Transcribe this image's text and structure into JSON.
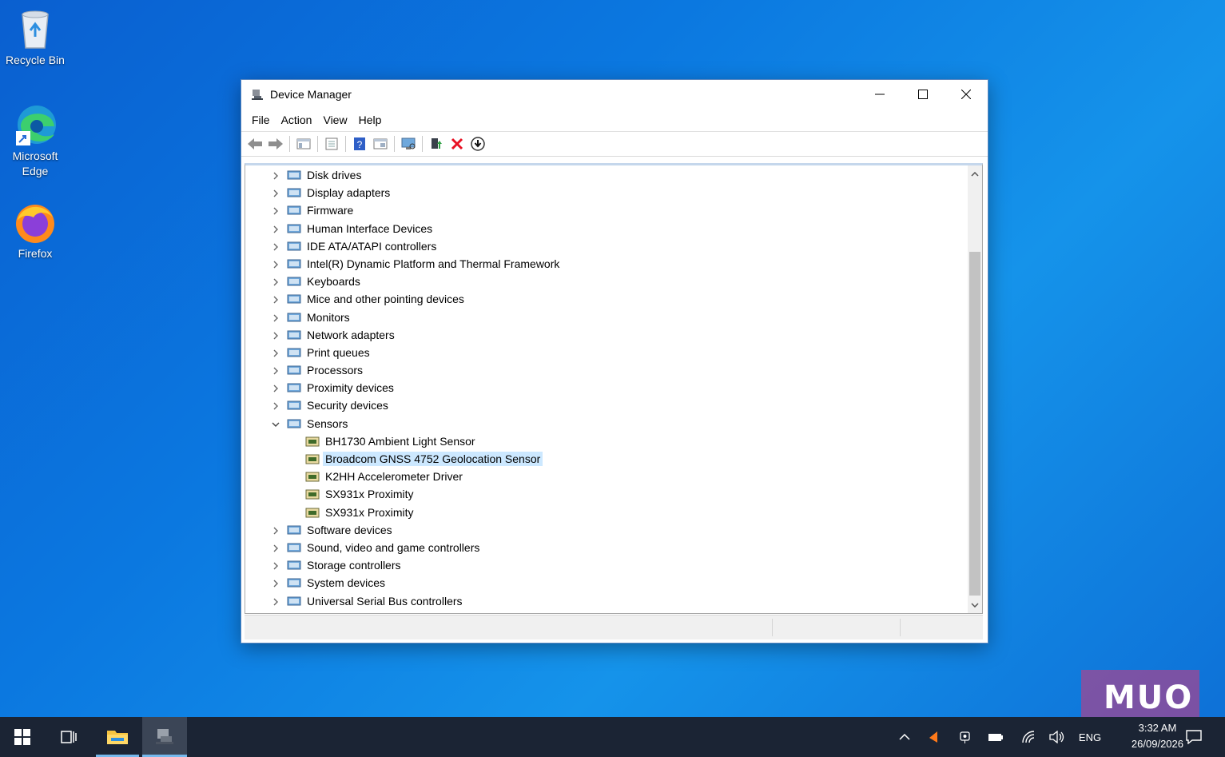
{
  "desktop": {
    "icons": [
      {
        "label": "Recycle Bin",
        "icon": "recycle-bin-icon"
      },
      {
        "label": "Microsoft Edge",
        "icon": "edge-icon"
      },
      {
        "label": "Firefox",
        "icon": "firefox-icon"
      }
    ]
  },
  "window": {
    "title": "Device Manager",
    "menu": [
      "File",
      "Action",
      "View",
      "Help"
    ],
    "toolbar": [
      "back-icon",
      "forward-icon",
      "show-hide-tree-icon",
      "properties-icon",
      "help-icon",
      "view-icon",
      "scan-hardware-icon",
      "update-driver-icon",
      "uninstall-icon",
      "download-icon"
    ]
  },
  "tree": {
    "categories_before": [
      "Disk drives",
      "Display adapters",
      "Firmware",
      "Human Interface Devices",
      "IDE ATA/ATAPI controllers",
      "Intel(R) Dynamic Platform and Thermal Framework",
      "Keyboards",
      "Mice and other pointing devices",
      "Monitors",
      "Network adapters",
      "Print queues",
      "Processors",
      "Proximity devices",
      "Security devices"
    ],
    "expanded_category": "Sensors",
    "sensors": [
      "BH1730 Ambient Light Sensor",
      "Broadcom GNSS 4752 Geolocation Sensor",
      "K2HH Accelerometer Driver",
      "SX931x Proximity",
      "SX931x Proximity"
    ],
    "selected_sensor": "Broadcom GNSS 4752 Geolocation Sensor",
    "categories_after": [
      "Software devices",
      "Sound, video and game controllers",
      "Storage controllers",
      "System devices",
      "Universal Serial Bus controllers"
    ]
  },
  "taskbar": {
    "lang": "ENG",
    "time": "3:32 AM",
    "date": "26/09/2026"
  },
  "watermark": "MUO",
  "colors": {
    "desktop": "#0b78e0",
    "taskbar": "#1b2434",
    "selection": "#cce8ff"
  }
}
